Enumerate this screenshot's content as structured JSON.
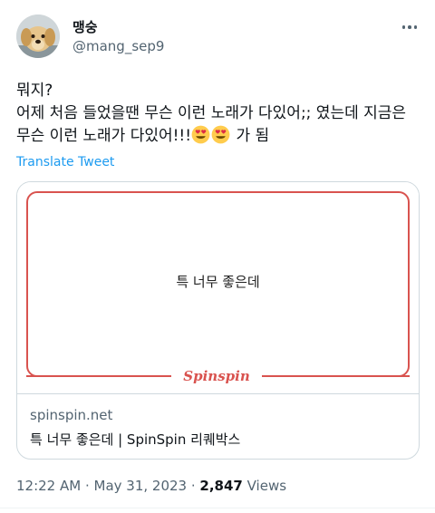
{
  "author": {
    "display_name": "맹숭",
    "handle": "@mang_sep9"
  },
  "tweet": {
    "lines": [
      "뭐지?",
      "어제 처음 들었을땐 무슨 이런 노래가 다있어;; 였는데 지금은",
      "무슨 이런 노래가 다있어!!!"
    ],
    "line3_suffix": " 가 됨",
    "emojis": [
      "heart-eyes-emoji",
      "heart-eyes-emoji"
    ],
    "translate_label": "Translate Tweet"
  },
  "card": {
    "media_text": "특 너무 좋은데",
    "brand_logo": "Spinspin",
    "domain": "spinspin.net",
    "title": "특 너무 좋은데 | SpinSpin 리퀘박스"
  },
  "meta": {
    "time": "12:22 AM",
    "sep1": " · ",
    "date": "May 31, 2023",
    "sep2": " · ",
    "views_count": "2,847",
    "views_label": " Views"
  },
  "colors": {
    "link": "#1d9bf0",
    "secondary_text": "#536471",
    "brand_red": "#d9534f"
  }
}
